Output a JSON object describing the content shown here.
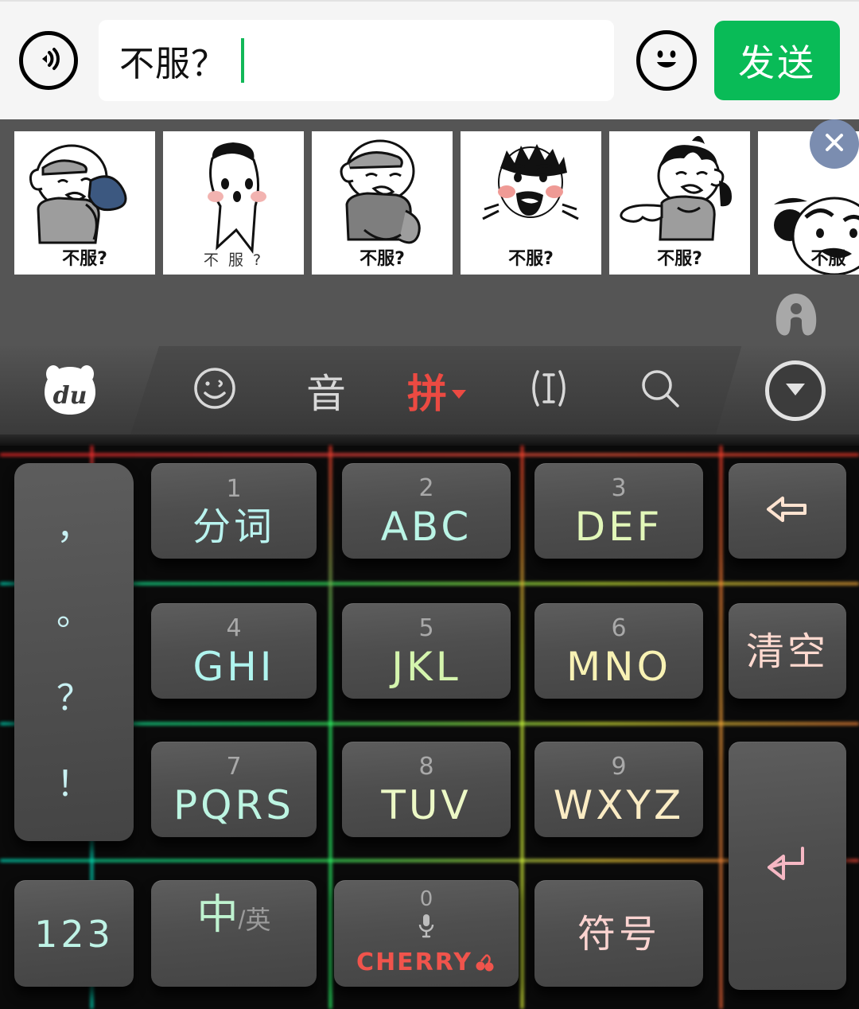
{
  "input_bar": {
    "voice_icon": "voice-wave-icon",
    "text_value": "不服？",
    "emoji_icon": "smiley-face-icon",
    "send_label": "发送"
  },
  "sticker_strip": {
    "close_icon": "close-icon",
    "watermark_icon": "app-watermark-icon",
    "stickers": [
      {
        "caption": "不服?",
        "alt": "bald-man-with-fist-sticker"
      },
      {
        "caption": "不 服 ?",
        "alt": "cute-round-face-sticker"
      },
      {
        "caption": "不服?",
        "alt": "man-rolling-sleeve-sticker"
      },
      {
        "caption": "不服?",
        "alt": "bearded-shouting-man-sticker"
      },
      {
        "caption": "不服?",
        "alt": "girl-pointing-sticker"
      },
      {
        "caption": "不服",
        "alt": "panda-face-sticker"
      }
    ]
  },
  "keyboard": {
    "brand_logo": "baidu-du-logo",
    "toolbar": [
      {
        "name": "emoji-icon",
        "glyph": "☺",
        "color": "#d8d8d8"
      },
      {
        "name": "voice-input-icon",
        "glyph": "音",
        "color": "#d8d8d8"
      },
      {
        "name": "pinyin-mode-icon",
        "glyph": "拼",
        "color": "#ec4a42"
      },
      {
        "name": "cursor-edit-icon",
        "glyph": "⟨I⟩",
        "color": "#d8d8d8"
      },
      {
        "name": "search-icon",
        "glyph": "🔍",
        "color": "#d8d8d8"
      }
    ],
    "collapse_icon": "chevron-down-icon",
    "punctuation": [
      "，",
      "。",
      "？",
      "！"
    ],
    "keys": [
      {
        "num": "1",
        "label": "分词",
        "color": "#b9f3ef",
        "cn": true
      },
      {
        "num": "2",
        "label": "ABC",
        "color": "#baf5e6"
      },
      {
        "num": "3",
        "label": "DEF",
        "color": "#e2f7b9"
      },
      {
        "num": "4",
        "label": "GHI",
        "color": "#b0f5ef"
      },
      {
        "num": "5",
        "label": "JKL",
        "color": "#d5f5ae"
      },
      {
        "num": "6",
        "label": "MNO",
        "color": "#f8f2b4"
      },
      {
        "num": "7",
        "label": "PQRS",
        "color": "#bdf5e2"
      },
      {
        "num": "8",
        "label": "TUV",
        "color": "#ecf8c6"
      },
      {
        "num": "9",
        "label": "WXYZ",
        "color": "#fbecc4"
      }
    ],
    "backspace_icon": "backspace-arrow-icon",
    "clear_label": "清空",
    "enter_icon": "enter-return-icon",
    "num_label": "123",
    "lang_cn": "中",
    "lang_sep": "/",
    "lang_en": "英",
    "space_num": "0",
    "mic_icon": "microphone-icon",
    "space_brand": "CHERRY",
    "symbol_label": "符号",
    "colors": {
      "key_face": "#4e4e4e",
      "clear_text": "#ffd9cf",
      "enter_text": "#f6b8c4",
      "symbol_text": "#fbd3d0",
      "backspace_text": "#ffe3d0",
      "cherry_red": "#f0544c",
      "num_text": "#bff3e6"
    }
  }
}
